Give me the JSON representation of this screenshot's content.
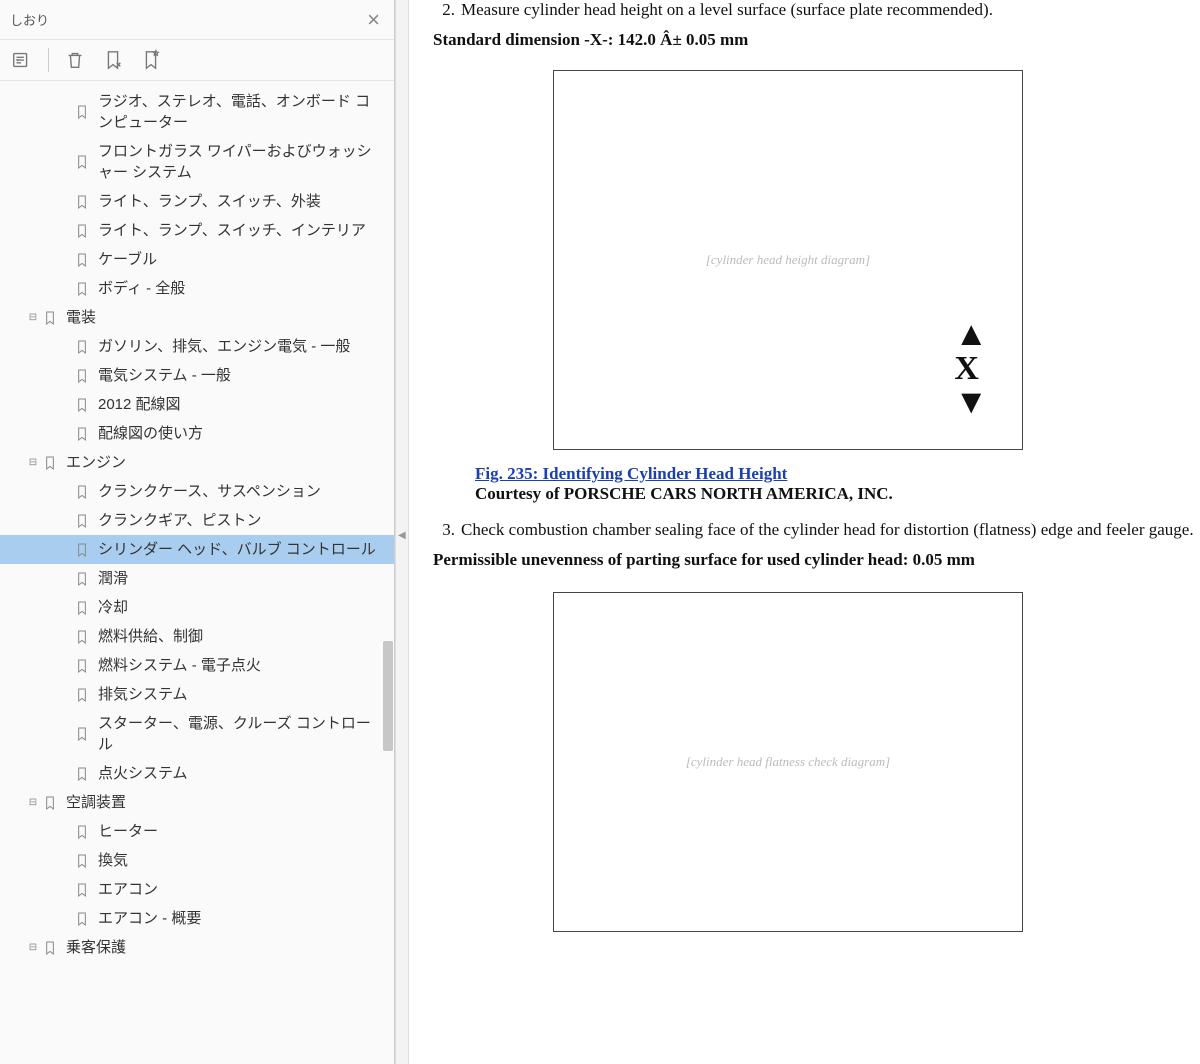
{
  "sidebar": {
    "title": "しおり",
    "tree": [
      {
        "level": 1,
        "label": "ラジオ、ステレオ、電話、オンボード コンピューター"
      },
      {
        "level": 1,
        "label": "フロントガラス ワイパーおよびウォッシャー システム"
      },
      {
        "level": 1,
        "label": "ライト、ランプ、スイッチ、外装"
      },
      {
        "level": 1,
        "label": "ライト、ランプ、スイッチ、インテリア"
      },
      {
        "level": 1,
        "label": "ケーブル"
      },
      {
        "level": 1,
        "label": "ボディ - 全般"
      },
      {
        "level": 0,
        "label": "電装",
        "expand": "minus"
      },
      {
        "level": 1,
        "label": "ガソリン、排気、エンジン電気 - 一般"
      },
      {
        "level": 1,
        "label": "電気システム - 一般"
      },
      {
        "level": 1,
        "label": "2012 配線図"
      },
      {
        "level": 1,
        "label": "配線図の使い方"
      },
      {
        "level": 0,
        "label": "エンジン",
        "expand": "minus"
      },
      {
        "level": 1,
        "label": "クランクケース、サスペンション"
      },
      {
        "level": 1,
        "label": "クランクギア、ピストン"
      },
      {
        "level": 1,
        "label": "シリンダー ヘッド、バルブ コントロール",
        "selected": true
      },
      {
        "level": 1,
        "label": "潤滑"
      },
      {
        "level": 1,
        "label": "冷却"
      },
      {
        "level": 1,
        "label": "燃料供給、制御"
      },
      {
        "level": 1,
        "label": "燃料システム - 電子点火"
      },
      {
        "level": 1,
        "label": "排気システム"
      },
      {
        "level": 1,
        "label": "スターター、電源、クルーズ コントロール"
      },
      {
        "level": 1,
        "label": "点火システム"
      },
      {
        "level": 0,
        "label": "空調装置",
        "expand": "minus"
      },
      {
        "level": 1,
        "label": "ヒーター"
      },
      {
        "level": 1,
        "label": "換気"
      },
      {
        "level": 1,
        "label": "エアコン"
      },
      {
        "level": 1,
        "label": "エアコン - 概要"
      },
      {
        "level": 0,
        "label": "乗客保護",
        "expand": "minus"
      }
    ]
  },
  "doc": {
    "step2_num": "2.",
    "step2_text": "Measure cylinder head height on a level surface (surface plate recommended).",
    "step2_dim": "Standard dimension -X-: 142.0 Â± 0.05 mm",
    "fig1_marker": "X",
    "fig1_caption": "Fig. 235: Identifying Cylinder Head Height",
    "fig1_credit": "Courtesy of PORSCHE CARS NORTH AMERICA, INC.",
    "step3_num": "3.",
    "step3_text": "Check combustion chamber sealing face of the cylinder head for distortion (flatness) edge and feeler gauge.",
    "step3_perm": "Permissible unevenness of parting surface for used cylinder head: 0.05 mm"
  }
}
